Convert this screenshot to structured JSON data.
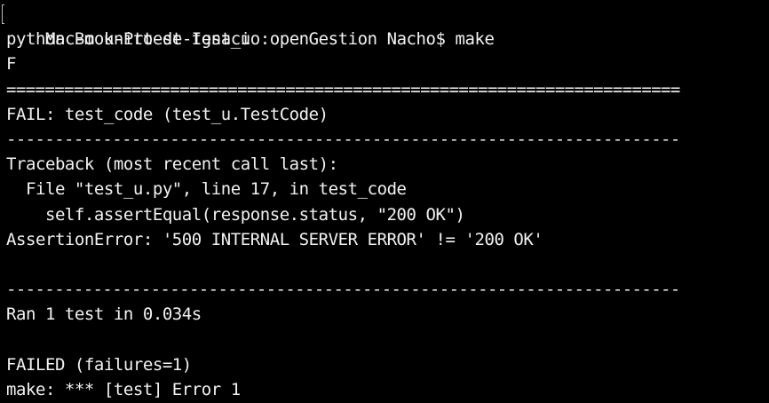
{
  "terminal": {
    "lines": {
      "prompt_line": "MacBook-Pro-de-Ignacio:openGestion Nacho$ make",
      "command_line": "python -m unittest test_u",
      "result_char": "F",
      "double_rule": "======================================================================",
      "fail_header": "FAIL: test_code (test_u.TestCode)",
      "single_rule_1": "----------------------------------------------------------------------",
      "traceback_header": "Traceback (most recent call last):",
      "traceback_file": "  File \"test_u.py\", line 17, in test_code",
      "traceback_code": "    self.assertEqual(response.status, \"200 OK\")",
      "assertion_error": "AssertionError: '500 INTERNAL SERVER ERROR' != '200 OK'",
      "blank_1": "",
      "single_rule_2": "----------------------------------------------------------------------",
      "ran_summary": "Ran 1 test in 0.034s",
      "blank_2": "",
      "failed_summary": "FAILED (failures=1)",
      "make_error": "make: *** [test] Error 1"
    }
  }
}
